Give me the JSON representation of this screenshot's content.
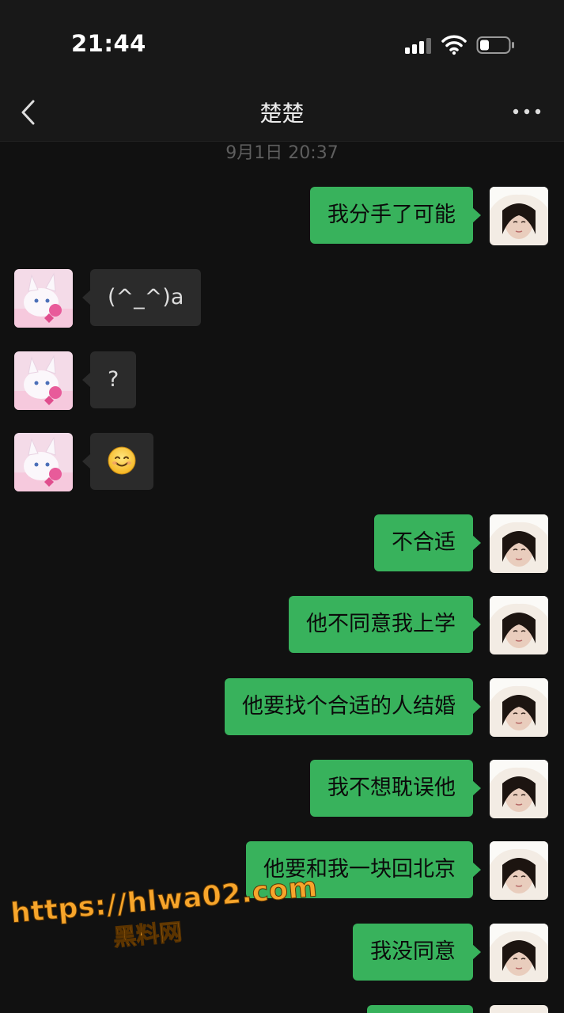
{
  "status_bar": {
    "time": "21:44",
    "icons": [
      "signal-icon",
      "wifi-icon",
      "battery-icon"
    ]
  },
  "header": {
    "back_icon": "back-icon",
    "title": "楚楚",
    "more_icon": "more-icon"
  },
  "timestamp": "9月1日 20:37",
  "messages": [
    {
      "side": "me",
      "text": "我分手了可能"
    },
    {
      "side": "other",
      "text": "(^_^)a"
    },
    {
      "side": "other",
      "text": "?"
    },
    {
      "side": "other",
      "text": "",
      "emoji": "smiling-face-icon"
    },
    {
      "side": "me",
      "text": "不合适"
    },
    {
      "side": "me",
      "text": "他不同意我上学"
    },
    {
      "side": "me",
      "text": "他要找个合适的人结婚"
    },
    {
      "side": "me",
      "text": "我不想耽误他"
    },
    {
      "side": "me",
      "text": "他要和我一块回北京"
    },
    {
      "side": "me",
      "text": "我没同意"
    }
  ],
  "watermark": {
    "url": "https://hlwa02.com",
    "name": "黑料网"
  },
  "colors": {
    "background": "#111111",
    "my_bubble": "#38b25c",
    "other_bubble": "#2b2b2b",
    "watermark": "#f7a52b"
  }
}
